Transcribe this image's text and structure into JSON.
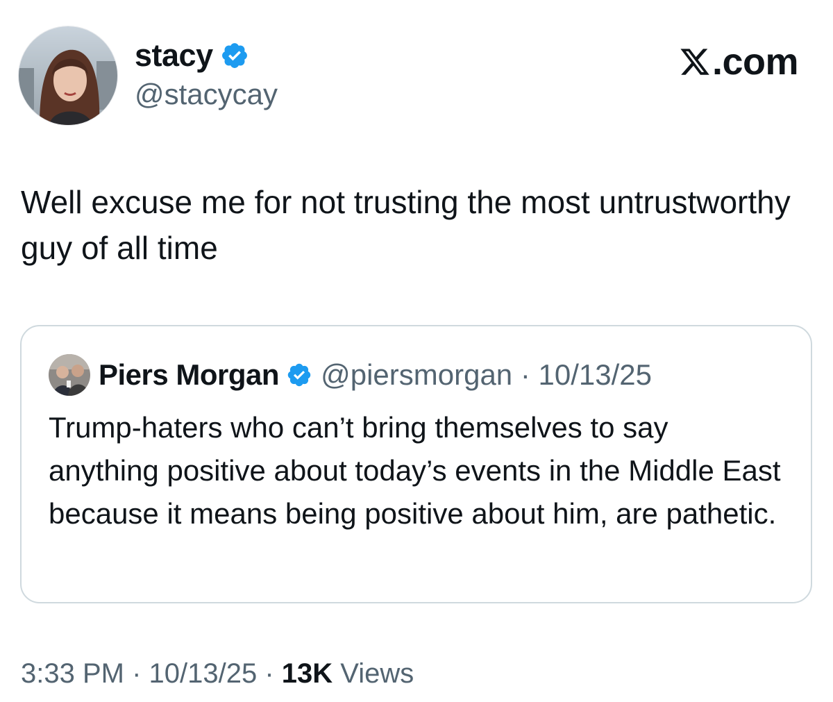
{
  "author": {
    "display_name": "stacy",
    "handle": "@stacycay",
    "verified_icon": "verified-badge-icon",
    "avatar": "profile-photo"
  },
  "brand": {
    "label": ".com",
    "icon": "x-logo-icon"
  },
  "tweet": {
    "text": "Well excuse me for not trusting the most untrustworthy guy of all time"
  },
  "quoted_tweet": {
    "display_name": "Piers Morgan",
    "handle_and_date": "@piersmorgan · 10/13/25",
    "text": "Trump-haters who can’t bring themselves to say anything positive about today’s events in the Middle East because it means being positive about him, are pathetic."
  },
  "footer": {
    "time_date": "3:33 PM · 10/13/25 · ",
    "views_count": "13K",
    "views_label": " Views"
  },
  "colors": {
    "verified_blue": "#1d9bf0",
    "secondary_text": "#536471",
    "primary_text": "#0f1419",
    "card_border": "#cfd9de"
  }
}
